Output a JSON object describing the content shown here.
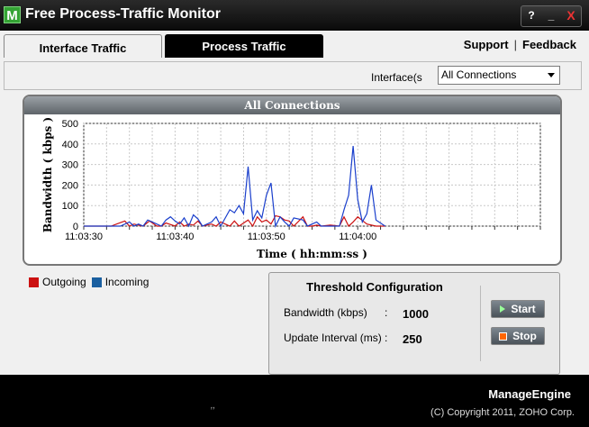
{
  "window": {
    "icon_letter": "M",
    "title": "Free Process-Traffic Monitor",
    "help_btn": "?",
    "minimize_btn": "_",
    "close_btn": "X"
  },
  "tabs": [
    {
      "label": "Interface Traffic",
      "active": true
    },
    {
      "label": "Process Traffic",
      "active": false
    }
  ],
  "links": {
    "support": "Support",
    "separator": "|",
    "feedback": "Feedback"
  },
  "interface": {
    "label": "Interface(s",
    "selected": "All Connections"
  },
  "chart_panel_title": "All Connections",
  "chart_data": {
    "type": "line",
    "xlabel": "Time ( hh:mm:ss )",
    "ylabel": "Bandwidth ( kbps )",
    "ylim": [
      0,
      500
    ],
    "yticks": [
      0,
      100,
      200,
      300,
      400,
      500
    ],
    "xlim": [
      0,
      50
    ],
    "xtick_labels": [
      {
        "x": 0,
        "label": "11:03:30"
      },
      {
        "x": 10,
        "label": "11:03:40"
      },
      {
        "x": 20,
        "label": "11:03:50"
      },
      {
        "x": 30,
        "label": "11:04:00"
      }
    ],
    "grid": true,
    "series": [
      {
        "name": "Outgoing",
        "color": "#cc1111",
        "x": [
          0,
          3,
          4.5,
          5,
          5.5,
          6,
          6.5,
          7.2,
          8,
          8.5,
          9,
          10,
          10.5,
          11,
          11.5,
          12,
          12.5,
          13,
          14,
          14.5,
          15,
          16,
          16.5,
          17,
          18,
          18.5,
          19,
          19.5,
          20,
          20.5,
          21,
          21.5,
          22,
          22.5,
          23,
          24,
          24.5,
          25,
          25.5,
          26,
          27,
          28,
          28.5,
          29,
          29.5,
          30,
          31,
          32,
          33
        ],
        "y": [
          0,
          0,
          25,
          0,
          10,
          5,
          0,
          25,
          0,
          0,
          15,
          0,
          20,
          0,
          10,
          5,
          25,
          0,
          10,
          0,
          20,
          0,
          25,
          0,
          30,
          0,
          45,
          20,
          30,
          10,
          50,
          45,
          30,
          25,
          0,
          45,
          0,
          0,
          5,
          0,
          5,
          0,
          45,
          0,
          20,
          45,
          10,
          0,
          0
        ]
      },
      {
        "name": "Incoming",
        "color": "#1a3fcc",
        "x": [
          0,
          4,
          5,
          5.5,
          6,
          6.5,
          7,
          7.5,
          8.5,
          9,
          9.5,
          10,
          10.5,
          11,
          11.5,
          12,
          12.5,
          13,
          14,
          14.5,
          15,
          16,
          16.5,
          17,
          17.5,
          18,
          18.5,
          19,
          19.5,
          20,
          20.5,
          21,
          21.5,
          22,
          22.5,
          23,
          24,
          24.5,
          25,
          25.5,
          26,
          27,
          28,
          28.5,
          29,
          29.5,
          30,
          30.5,
          31,
          31.5,
          32,
          33
        ],
        "y": [
          0,
          0,
          20,
          0,
          10,
          0,
          30,
          20,
          0,
          30,
          45,
          25,
          10,
          40,
          0,
          55,
          35,
          0,
          20,
          45,
          0,
          80,
          65,
          100,
          60,
          290,
          30,
          75,
          40,
          150,
          210,
          0,
          45,
          20,
          0,
          40,
          30,
          0,
          10,
          20,
          0,
          0,
          0,
          80,
          150,
          390,
          130,
          20,
          60,
          200,
          30,
          0
        ]
      }
    ]
  },
  "legend": [
    {
      "label": "Outgoing",
      "color": "#cc1111"
    },
    {
      "label": "Incoming",
      "color": "#1a5fa0"
    }
  ],
  "threshold": {
    "title": "Threshold Configuration",
    "bandwidth_label": "Bandwidth (kbps)",
    "bandwidth_value": "1000",
    "interval_label": "Update Interval (ms)",
    "interval_value": "250",
    "colon": ":",
    "start_label": "Start",
    "stop_label": "Stop"
  },
  "footer": {
    "mark": "‚‚",
    "brand": "ManageEngine",
    "copyright": "(C) Copyright 2011, ZOHO Corp."
  }
}
